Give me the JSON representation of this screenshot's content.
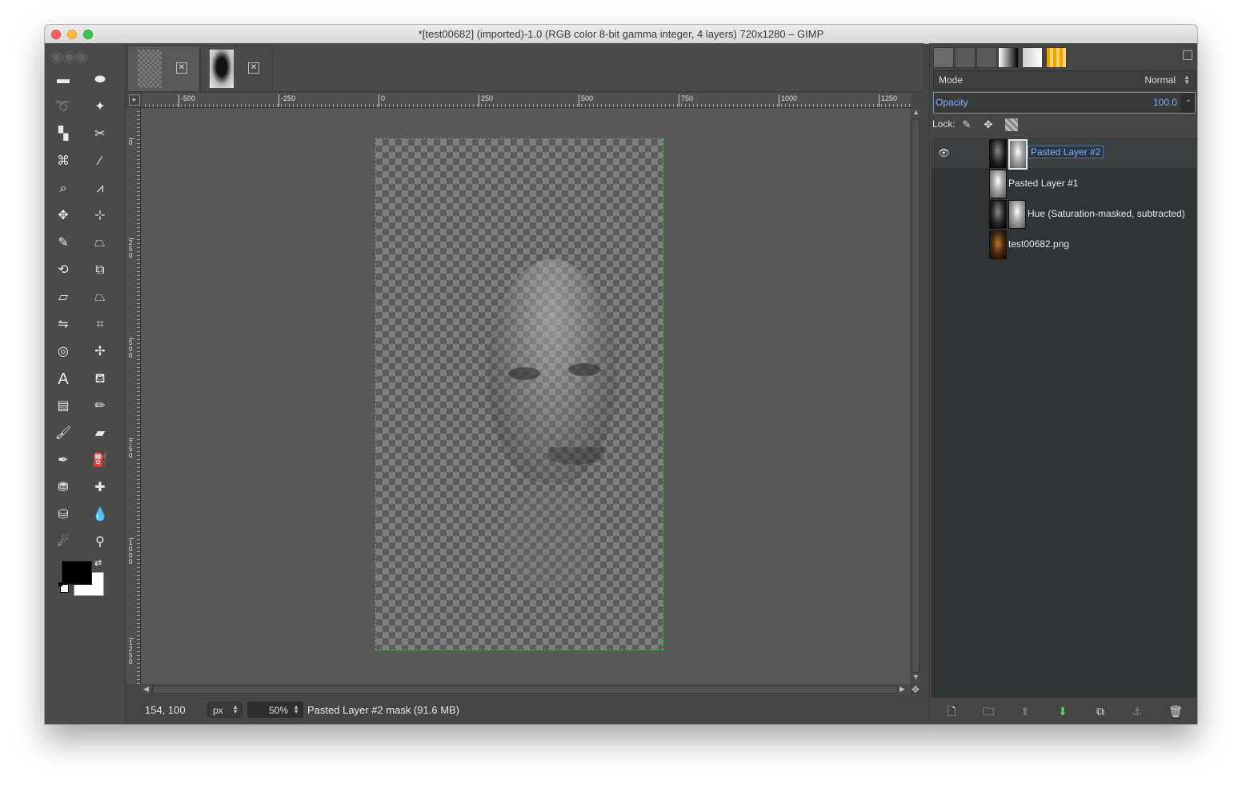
{
  "window": {
    "title": "*[test00682] (imported)-1.0 (RGB color 8-bit gamma integer, 4 layers) 720x1280 – GIMP"
  },
  "toolbox": {
    "tools": [
      "rect-select-icon",
      "ellipse-select-icon",
      "free-select-icon",
      "fuzzy-select-icon",
      "select-by-color-icon",
      "scissors-select-icon",
      "paths-icon",
      "color-picker-icon",
      "zoom-icon",
      "measure-icon",
      "move-icon",
      "align-icon",
      "crop-icon",
      "unified-transform-icon",
      "rotate-icon",
      "scale-icon",
      "shear-icon",
      "perspective-icon",
      "flip-icon",
      "cage-transform-icon",
      "warp-icon",
      "handle-transform-icon",
      "text-icon",
      "bucket-fill-icon",
      "blend-icon",
      "pencil-icon",
      "paintbrush-icon",
      "eraser-icon",
      "airbrush-icon",
      "ink-icon",
      "clone-icon",
      "heal-icon",
      "perspective-clone-icon",
      "blur-icon",
      "smudge-icon",
      "dodge-burn-icon"
    ],
    "fg_color": "#000000",
    "bg_color": "#ffffff"
  },
  "ruler": {
    "h_ticks": [
      "-500",
      "-250",
      "0",
      "250",
      "500",
      "750",
      "1000",
      "1250"
    ],
    "v_ticks": [
      "0",
      "250",
      "500",
      "750",
      "1000",
      "1250"
    ]
  },
  "status": {
    "coords": "154, 100",
    "unit": "px",
    "zoom": "50%",
    "message": "Pasted Layer #2 mask (91.6 MB)"
  },
  "dock": {
    "mode_label": "Mode",
    "mode_value": "Normal",
    "opacity_label": "Opacity",
    "opacity_value": "100.0",
    "lock_label": "Lock:"
  },
  "layers": [
    {
      "name": "Pasted Layer #2",
      "visible": true,
      "selected": true
    },
    {
      "name": "Pasted Layer #1",
      "visible": false,
      "selected": false
    },
    {
      "name": "Hue (Saturation-masked, subtracted)",
      "visible": false,
      "selected": false
    },
    {
      "name": "test00682.png",
      "visible": false,
      "selected": false
    }
  ]
}
